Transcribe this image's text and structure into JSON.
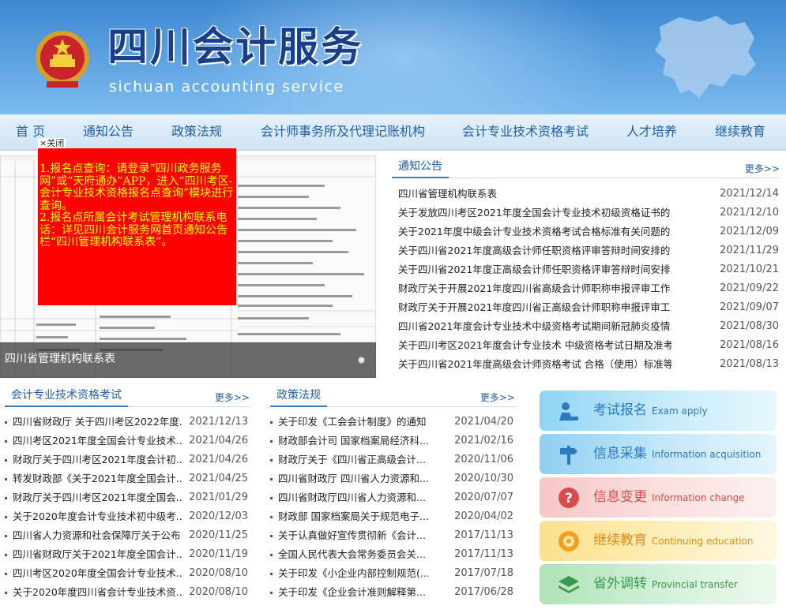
{
  "header": {
    "title": "四川会计服务",
    "subtitle": "sichuan accounting service"
  },
  "nav": [
    "首 页",
    "通知公告",
    "政策法规",
    "会计师事务所及代理记账机构",
    "会计专业技术资格考试",
    "人才培养",
    "继续教育"
  ],
  "popup": {
    "close": "×关闭",
    "line1": "1.报名点查询：请登录“四川政务服务网”或“天府通办”APP，进入“四川考区-会计专业技术资格报名点查询”模块进行查询。",
    "line2": "2.报名点所属会计考试管理机构联系电话：详见四川会计服务网首页通知公告栏“四川管理机构联系表”。"
  },
  "slider": {
    "caption": "四川省管理机构联系表"
  },
  "notices": {
    "title": "通知公告",
    "more": "更多>>",
    "items": [
      {
        "text": "四川省管理机构联系表",
        "date": "2021/12/14"
      },
      {
        "text": "关于发放四川考区2021年度全国会计专业技术初级资格证书的...",
        "date": "2021/12/10"
      },
      {
        "text": "关于2021年度中级会计专业技术资格考试合格标准有关问题的...",
        "date": "2021/12/09"
      },
      {
        "text": "关于四川省2021年度高级会计师任职资格评审答辩时间安排的...",
        "date": "2021/11/29"
      },
      {
        "text": "关于四川省2021年度正高级会计师任职资格评审答辩时间安排...",
        "date": "2021/10/21"
      },
      {
        "text": "财政厅关于开展2021年度四川省高级会计师职称申报评审工作...",
        "date": "2021/09/22"
      },
      {
        "text": "财政厅关于开展2021年度四川省正高级会计师职称申报评审工...",
        "date": "2021/09/07"
      },
      {
        "text": "四川省2021年度会计专业技术中级资格考试期间新冠肺炎疫情...",
        "date": "2021/08/30"
      },
      {
        "text": "关于四川考区2021年度会计专业技术 中级资格考试日期及准考...",
        "date": "2021/08/16"
      },
      {
        "text": "关于四川省2021年度高级会计师资格考试 合格（使用）标准等...",
        "date": "2021/08/13"
      }
    ]
  },
  "exams": {
    "title": "会计专业技术资格考试",
    "more": "更多>>",
    "items": [
      {
        "text": "四川省财政厅 关于四川考区2022年度...",
        "date": "2021/12/13"
      },
      {
        "text": "四川考区2021年度全国会计专业技术...",
        "date": "2021/04/26"
      },
      {
        "text": "财政厅关于四川考区2021年度会计初...",
        "date": "2021/04/26"
      },
      {
        "text": "转发财政部《关于2021年度全国会计...",
        "date": "2021/04/25"
      },
      {
        "text": "财政厅关于四川考区2021年度全国会...",
        "date": "2021/01/29"
      },
      {
        "text": "关于2020年度会计专业技术初中级考...",
        "date": "2020/12/03"
      },
      {
        "text": "四川省人力资源和社会保障厅关于公布...",
        "date": "2020/11/25"
      },
      {
        "text": "四川省财政厅关于2021年度全国会计...",
        "date": "2020/11/19"
      },
      {
        "text": "四川考区2020年度全国会计专业技术...",
        "date": "2020/08/10"
      },
      {
        "text": "关于2020年度四川省会计专业技术资...",
        "date": "2020/08/10"
      }
    ]
  },
  "policies": {
    "title": "政策法规",
    "more": "更多>>",
    "items": [
      {
        "text": "关于印发《工会会计制度》的通知",
        "date": "2021/04/20"
      },
      {
        "text": "财政部会计司 国家档案局经济科...",
        "date": "2021/02/16"
      },
      {
        "text": "财政厅关于《四川省正高级会计...",
        "date": "2020/11/06"
      },
      {
        "text": "四川省财政厅 四川省人力资源和...",
        "date": "2020/10/30"
      },
      {
        "text": "四川省财政厅四川省人力资源和...",
        "date": "2020/07/07"
      },
      {
        "text": "财政部 国家档案局关于规范电子...",
        "date": "2020/04/02"
      },
      {
        "text": "关于认真做好宣传贯彻新《会计...",
        "date": "2017/11/13"
      },
      {
        "text": "全国人民代表大会常务委员会关...",
        "date": "2017/11/13"
      },
      {
        "text": "关于印发《小企业内部控制规范(...",
        "date": "2017/07/18"
      },
      {
        "text": "关于印发《企业会计准则解释第...",
        "date": "2017/06/28"
      }
    ]
  },
  "side_buttons": [
    {
      "cn": "考试报名",
      "en": "Exam apply",
      "icon": "person-desk-icon",
      "color": "#2e78c2"
    },
    {
      "cn": "信息采集",
      "en": "Information acquisition",
      "icon": "signpost-icon",
      "color": "#2e78c2"
    },
    {
      "cn": "信息变更",
      "en": "Information change",
      "icon": "question-icon",
      "color": "#d94a4a"
    },
    {
      "cn": "继续教育",
      "en": "Continuing education",
      "icon": "book-icon",
      "color": "#e08a1a"
    },
    {
      "cn": "省外调转",
      "en": "Provincial transfer",
      "icon": "layers-icon",
      "color": "#3a9a4a"
    }
  ]
}
